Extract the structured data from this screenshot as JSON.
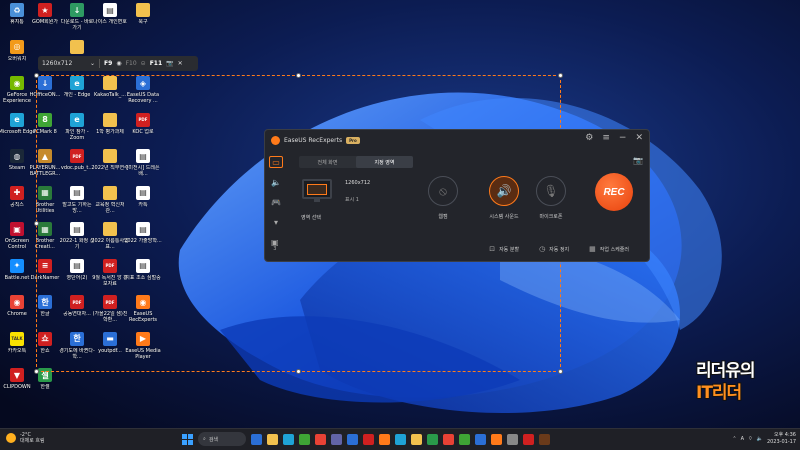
{
  "desktop": {
    "icons": [
      {
        "label": "휴지통",
        "icon": "recycle-bin-icon",
        "color": "#4a90d9",
        "glyph": "♻"
      },
      {
        "label": "GOM회원가",
        "icon": "app-icon",
        "color": "#d02020",
        "glyph": "★"
      },
      {
        "label": "다운로드 - 바로 가기",
        "icon": "folder-shortcut-icon",
        "color": "#2e9a62",
        "glyph": "↓"
      },
      {
        "label": "나이스 개인변호",
        "icon": "doc-icon",
        "color": "#ffffff",
        "glyph": "▤"
      },
      {
        "label": "북구",
        "icon": "folder-icon",
        "color": "#f2c14e",
        "glyph": ""
      },
      {
        "label": "오버워치",
        "icon": "game-icon",
        "color": "#f29a1a",
        "glyph": "◎"
      },
      {
        "label": "GeForce Experience",
        "icon": "nvidia-icon",
        "color": "#76b900",
        "glyph": "◉"
      },
      {
        "label": "Microsoft Edge",
        "icon": "edge-icon",
        "color": "#1fa3d6",
        "glyph": "e"
      },
      {
        "label": "Steam",
        "icon": "steam-icon",
        "color": "#1b2838",
        "glyph": "◍"
      },
      {
        "label": "공칙스",
        "icon": "app-icon",
        "color": "#d02020",
        "glyph": "✚"
      },
      {
        "label": "OnScreen Control",
        "icon": "app-icon",
        "color": "#c01030",
        "glyph": "▣"
      },
      {
        "label": "Battle.net",
        "icon": "battlenet-icon",
        "color": "#148eff",
        "glyph": "✦"
      },
      {
        "label": "Chrome",
        "icon": "chrome-icon",
        "color": "#e94235",
        "glyph": "◉"
      },
      {
        "label": "카카오톡",
        "icon": "kakaotalk-icon",
        "color": "#fae100",
        "glyph": "TALK"
      },
      {
        "label": "CLIPDOWN",
        "icon": "app-icon",
        "color": "#d02020",
        "glyph": "▼"
      },
      {
        "label": "HOfficeON...",
        "icon": "app-icon",
        "color": "#2b6fd6",
        "glyph": "↓"
      },
      {
        "label": "PCMark 8",
        "icon": "app-icon",
        "color": "#3fa535",
        "glyph": "8"
      },
      {
        "label": "PLAYERUN... BATTLEGR...",
        "icon": "game-icon",
        "color": "#c68a2b",
        "glyph": "▲"
      },
      {
        "label": "Brother Utilities",
        "icon": "app-icon",
        "color": "#2a7a3a",
        "glyph": "▦"
      },
      {
        "label": "Brother Creati...",
        "icon": "app-icon",
        "color": "#2a7a3a",
        "glyph": "▦"
      },
      {
        "label": "DarkNamer",
        "icon": "app-icon",
        "color": "#d02020",
        "glyph": "≡"
      },
      {
        "label": "한글",
        "icon": "hwp-icon",
        "color": "#2b6fd6",
        "glyph": "한"
      },
      {
        "label": "한쇼",
        "icon": "hwp-icon",
        "color": "#d02020",
        "glyph": "쇼"
      },
      {
        "label": "한셀",
        "icon": "hwp-icon",
        "color": "#2a9a4a",
        "glyph": "셀"
      },
      {
        "label": "GPKI",
        "icon": "folder-icon",
        "color": "#f2c14e",
        "glyph": ""
      },
      {
        "label": "개인 - Edge",
        "icon": "edge-icon",
        "color": "#1fa3d6",
        "glyph": "e"
      },
      {
        "label": "파인 참가 - Zoom",
        "icon": "edge-icon",
        "color": "#1fa3d6",
        "glyph": "e"
      },
      {
        "label": "vdoc.pub_t...",
        "icon": "pdf-icon",
        "color": "#d02020",
        "glyph": "PDF"
      },
      {
        "label": "발고도 기하는 방...",
        "icon": "doc-icon",
        "color": "#ffffff",
        "glyph": "▤"
      },
      {
        "label": "2022-1 화정 신기",
        "icon": "doc-icon",
        "color": "#ffffff",
        "glyph": "▤"
      },
      {
        "label": "영단어(2)",
        "icon": "doc-icon",
        "color": "#ffffff",
        "glyph": "▤"
      },
      {
        "label": "공동연대자...",
        "icon": "pdf-icon",
        "color": "#d02020",
        "glyph": "PDF"
      },
      {
        "label": "경기도에 바뀐다-학...",
        "icon": "hwp-icon",
        "color": "#2b6fd6",
        "glyph": "한"
      },
      {
        "label": "KakaoTalk_...",
        "icon": "folder-icon",
        "color": "#f2c14e",
        "glyph": ""
      },
      {
        "label": "1학 평가과제",
        "icon": "folder-icon",
        "color": "#f2c14e",
        "glyph": ""
      },
      {
        "label": "2022년 직무연수",
        "icon": "folder-icon",
        "color": "#f2c14e",
        "glyph": ""
      },
      {
        "label": "교육청 혁신처 관...",
        "icon": "folder-icon",
        "color": "#f2c14e",
        "glyph": ""
      },
      {
        "label": "2022 이름통사업표...",
        "icon": "folder-icon",
        "color": "#f2c14e",
        "glyph": ""
      },
      {
        "label": "9월 독서진 앙 홍보자료",
        "icon": "pdf-icon",
        "color": "#d02020",
        "glyph": "PDF"
      },
      {
        "label": "(가을22일 샘)진학환...",
        "icon": "pdf-icon",
        "color": "#d02020",
        "glyph": "PDF"
      },
      {
        "label": "youtpdf...",
        "icon": "app-icon",
        "color": "#2b6fd6",
        "glyph": "▬"
      },
      {
        "label": "EaseUS Data Recovery ...",
        "icon": "app-icon",
        "color": "#2b6fd6",
        "glyph": "◈"
      },
      {
        "label": "KOC 업로",
        "icon": "pdf-icon",
        "color": "#d02020",
        "glyph": "PDF"
      },
      {
        "label": "[미전시] 드레픈 배...",
        "icon": "doc-icon",
        "color": "#ffffff",
        "glyph": "▤"
      },
      {
        "label": "카톡",
        "icon": "doc-icon",
        "color": "#ffffff",
        "glyph": "▤"
      },
      {
        "label": "2022 가출방학...",
        "icon": "doc-icon",
        "color": "#ffffff",
        "glyph": "▤"
      },
      {
        "label": "지표 조소 심벌중",
        "icon": "doc-icon",
        "color": "#ffffff",
        "glyph": "▤"
      },
      {
        "label": "EaseUS RecExperts",
        "icon": "recexperts-icon",
        "color": "#ff7a1a",
        "glyph": "◉"
      },
      {
        "label": "EaseUS Media Player",
        "icon": "app-icon",
        "color": "#ff7a1a",
        "glyph": "▶"
      }
    ]
  },
  "size_toolbar": {
    "size_value": "1260x712",
    "pause_key": "F9",
    "stop_key": "F10",
    "screenshot_key": "F11"
  },
  "recexperts": {
    "app_name": "EaseUS RecExperts",
    "badge": "Pro",
    "tabs": [
      "전체 화면",
      "지정 영역"
    ],
    "resolution": "1260x712",
    "display": "표시 1",
    "area_select": "영역 선택",
    "sources": [
      {
        "label": "웹캠",
        "icon": "webcam-off-icon",
        "active": false
      },
      {
        "label": "시스템 사운드",
        "icon": "speaker-icon",
        "active": true
      },
      {
        "label": "마이크로폰",
        "icon": "mic-off-icon",
        "active": false
      }
    ],
    "rec_label": "REC",
    "bottom": [
      {
        "label": "자동 분할",
        "icon": "split-icon"
      },
      {
        "label": "자동 정지",
        "icon": "timer-icon"
      },
      {
        "label": "작업 스케줄러",
        "icon": "calendar-icon"
      }
    ],
    "recordings_count": "3"
  },
  "watermark": {
    "line1": "리더유의",
    "line2": "IT리더"
  },
  "taskbar": {
    "weather_temp": "-2°C",
    "weather_desc": "대체로 흐림",
    "search_label": "검색",
    "time": "오후 4:36",
    "date": "2023-01-17",
    "lang": "A"
  },
  "colors": {
    "accent": "#ff7a1a",
    "rec": "#f05a1a",
    "window_bg": "#23252b"
  }
}
